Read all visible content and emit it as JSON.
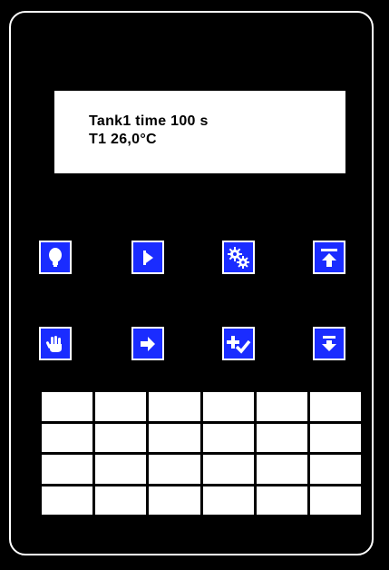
{
  "display": {
    "line1": "Tank1 time 100 s",
    "line2": "T1 26,0°C"
  },
  "keys_row1": [
    {
      "name": "light-bulb-key",
      "icon": "light-bulb-icon"
    },
    {
      "name": "play-key",
      "icon": "play-icon"
    },
    {
      "name": "settings-key",
      "icon": "gears-icon"
    },
    {
      "name": "top-key",
      "icon": "arrow-up-to-top-icon"
    }
  ],
  "keys_row2": [
    {
      "name": "manual-key",
      "icon": "hand-icon"
    },
    {
      "name": "enter-key",
      "icon": "arrow-right-icon"
    },
    {
      "name": "add-confirm-key",
      "icon": "plus-check-icon"
    },
    {
      "name": "bottom-key",
      "icon": "arrow-down-to-bottom-icon"
    }
  ],
  "colors": {
    "key_background": "#1a2cff",
    "panel_background": "#000000",
    "display_background": "#ffffff"
  },
  "keypad": {
    "rows": 4,
    "columns": 6
  }
}
